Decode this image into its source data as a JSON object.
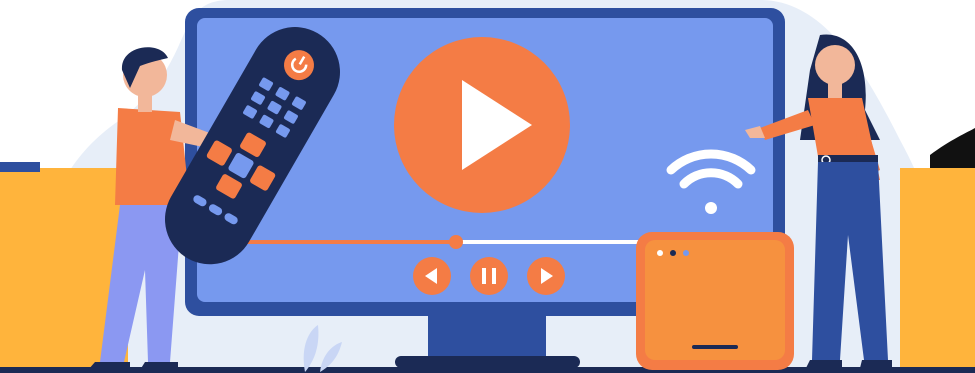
{
  "illustration": {
    "colors": {
      "screen": "#7699EE",
      "frame": "#2E4F9F",
      "accent": "#F47C45",
      "remote": "#1B2A55",
      "skin": "#F2B79A",
      "banner": "#FFB43C",
      "backdrop": "#E7EEF8"
    },
    "playback": {
      "progress": 0.45,
      "state": "paused"
    },
    "icons": [
      "play-icon",
      "rewind-icon",
      "pause-icon",
      "forward-icon",
      "wifi-icon",
      "power-icon"
    ]
  }
}
